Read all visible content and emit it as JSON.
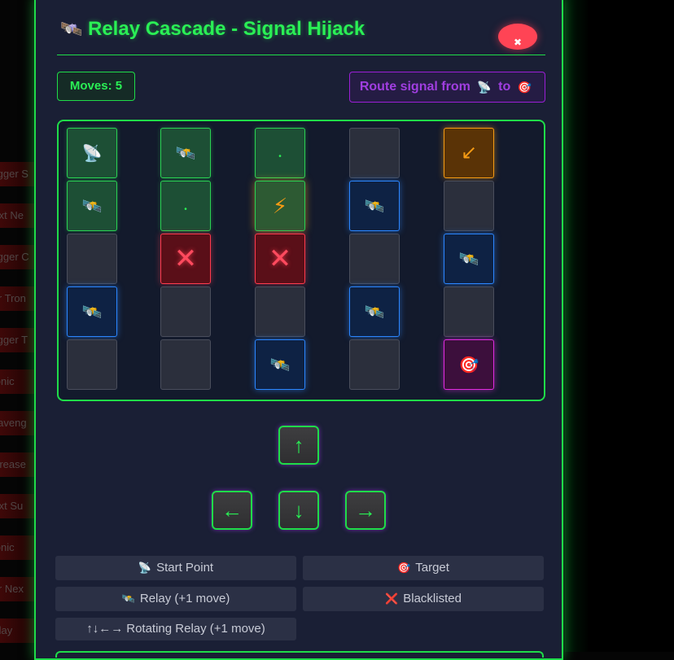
{
  "background": {
    "items": [
      "Trigger S",
      "Next Ne",
      "Trigger C",
      "Per Tron",
      "Trigger T",
      "Tronic",
      "Scaveng",
      "Increase",
      "Next Su",
      "Tronic",
      "Per Nex",
      "Relay"
    ]
  },
  "modal": {
    "title_icon": "🛰️",
    "title": "Relay Cascade - Signal Hijack",
    "close_icon": "✖",
    "moves": "Moves: 5",
    "instruction": {
      "prefix": "Route signal from",
      "start_icon": "📡",
      "middle": "to",
      "target_icon": "🎯"
    }
  },
  "board": {
    "rows": 5,
    "cols": 5,
    "cells": [
      [
        {
          "type": "path",
          "glyph": "📡"
        },
        {
          "type": "path",
          "glyph": "🛰️"
        },
        {
          "type": "path",
          "glyph": "•"
        },
        {
          "type": "empty",
          "glyph": ""
        },
        {
          "type": "rotating",
          "glyph": "↙"
        }
      ],
      [
        {
          "type": "path",
          "glyph": "🛰️"
        },
        {
          "type": "path",
          "glyph": "•"
        },
        {
          "type": "charged",
          "glyph": "⚡"
        },
        {
          "type": "relay",
          "glyph": "🛰️"
        },
        {
          "type": "empty",
          "glyph": ""
        }
      ],
      [
        {
          "type": "empty",
          "glyph": ""
        },
        {
          "type": "blocked",
          "glyph": "✕"
        },
        {
          "type": "blocked",
          "glyph": "✕"
        },
        {
          "type": "empty",
          "glyph": ""
        },
        {
          "type": "relay",
          "glyph": "🛰️"
        }
      ],
      [
        {
          "type": "relay",
          "glyph": "🛰️"
        },
        {
          "type": "empty",
          "glyph": ""
        },
        {
          "type": "empty",
          "glyph": ""
        },
        {
          "type": "relay",
          "glyph": "🛰️"
        },
        {
          "type": "empty",
          "glyph": ""
        }
      ],
      [
        {
          "type": "empty",
          "glyph": ""
        },
        {
          "type": "empty",
          "glyph": ""
        },
        {
          "type": "relay",
          "glyph": "🛰️"
        },
        {
          "type": "empty",
          "glyph": ""
        },
        {
          "type": "target",
          "glyph": "🎯"
        }
      ]
    ]
  },
  "controls": {
    "up": "↑",
    "left": "←",
    "down": "↓",
    "right": "→"
  },
  "legend": {
    "start": {
      "icon": "📡",
      "label": "Start Point"
    },
    "target": {
      "icon": "🎯",
      "label": "Target"
    },
    "relay": {
      "icon": "🛰️",
      "label": "Relay (+1 move)"
    },
    "blacklisted": {
      "icon": "❌",
      "label": "Blacklisted"
    },
    "rotating": {
      "icon": "↑↓←→",
      "label": "Rotating Relay (+1 move)"
    }
  }
}
